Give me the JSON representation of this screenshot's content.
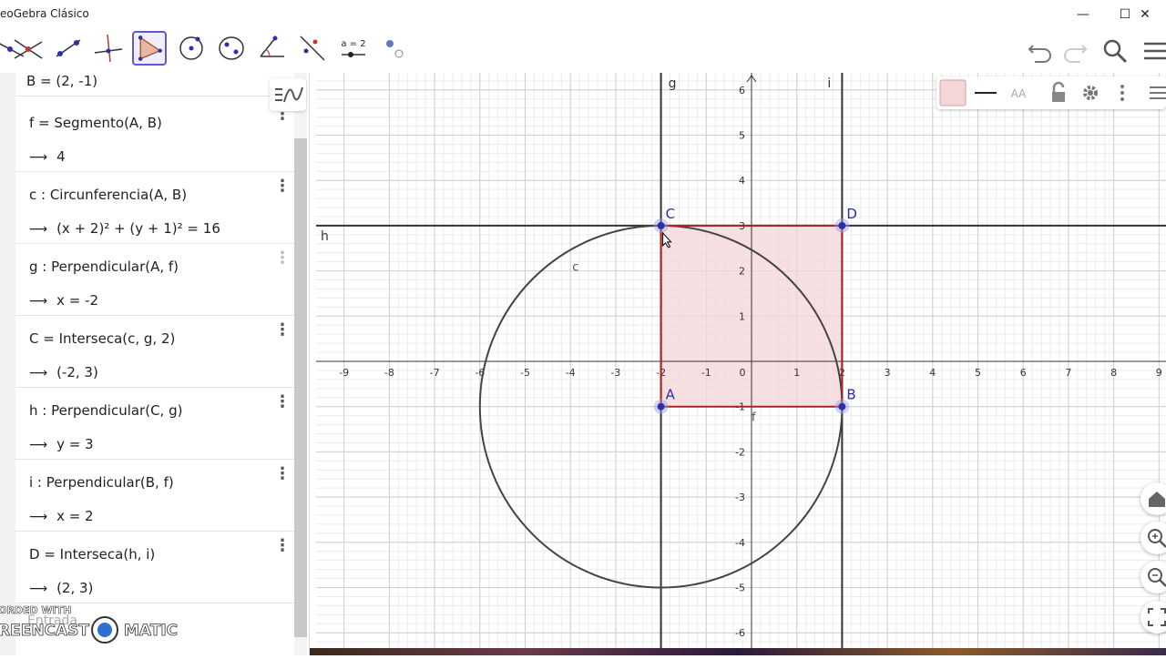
{
  "window": {
    "title": "eoGebra Clásico",
    "minimize": "—",
    "maximize": "☐",
    "close": "✕"
  },
  "toolbar": {
    "tools": [
      "move-tool",
      "point-tool",
      "line-tool",
      "perpendicular-line-tool",
      "polygon-tool",
      "circle-tool",
      "conic-tool",
      "angle-tool",
      "reflect-tool",
      "slider-tool",
      "show-hide-tool"
    ],
    "slider_label": "a = 2",
    "active_tool": "polygon-tool"
  },
  "algebra": {
    "top_partial": "B = (2, -1)",
    "rows": [
      {
        "def": "f = Segmento(A, B)",
        "val": "4"
      },
      {
        "def": "c : Circunferencia(A, B)",
        "val": "(x + 2)² + (y + 1)² = 16"
      },
      {
        "def": "g : Perpendicular(A, f)",
        "val": "x = -2"
      },
      {
        "def": "C = Interseca(c, g, 2)",
        "val": "(-2, 3)"
      },
      {
        "def": "h : Perpendicular(C, g)",
        "val": "y = 3"
      },
      {
        "def": "i : Perpendicular(B, f)",
        "val": "x = 2"
      },
      {
        "def": "D = Interseca(h, i)",
        "val": "(2, 3)"
      }
    ],
    "input_placeholder": "Entrada",
    "menu_glyph": "⋮"
  },
  "watermark": {
    "line1": "ORDED WITH",
    "line2": "REENCAST",
    "line3": "MATIC"
  },
  "graphics": {
    "x_ticks": [
      "-9",
      "-8",
      "-7",
      "-6",
      "-5",
      "-4",
      "-3",
      "-2",
      "-1",
      "0",
      "1",
      "2",
      "3",
      "4",
      "5",
      "6",
      "7",
      "8",
      "9"
    ],
    "y_ticks": [
      "6",
      "5",
      "4",
      "3",
      "2",
      "1",
      "-1",
      "-2",
      "-3",
      "-4",
      "-5",
      "-6"
    ],
    "line_labels": {
      "g": "g",
      "i": "i",
      "h": "h",
      "c": "c",
      "f": "f"
    },
    "points": [
      {
        "name": "A",
        "x": -2,
        "y": -1
      },
      {
        "name": "B",
        "x": 2,
        "y": -1
      },
      {
        "name": "C",
        "x": -2,
        "y": 3
      },
      {
        "name": "D",
        "x": 2,
        "y": 3
      }
    ],
    "circle": {
      "cx": -2,
      "cy": -1,
      "r": 4
    },
    "polygon_color": "#f4d6d8",
    "polygon_edge": "#b22222",
    "point_color": "#2b2fa8"
  },
  "style_bar": {
    "text_size": "AA"
  }
}
